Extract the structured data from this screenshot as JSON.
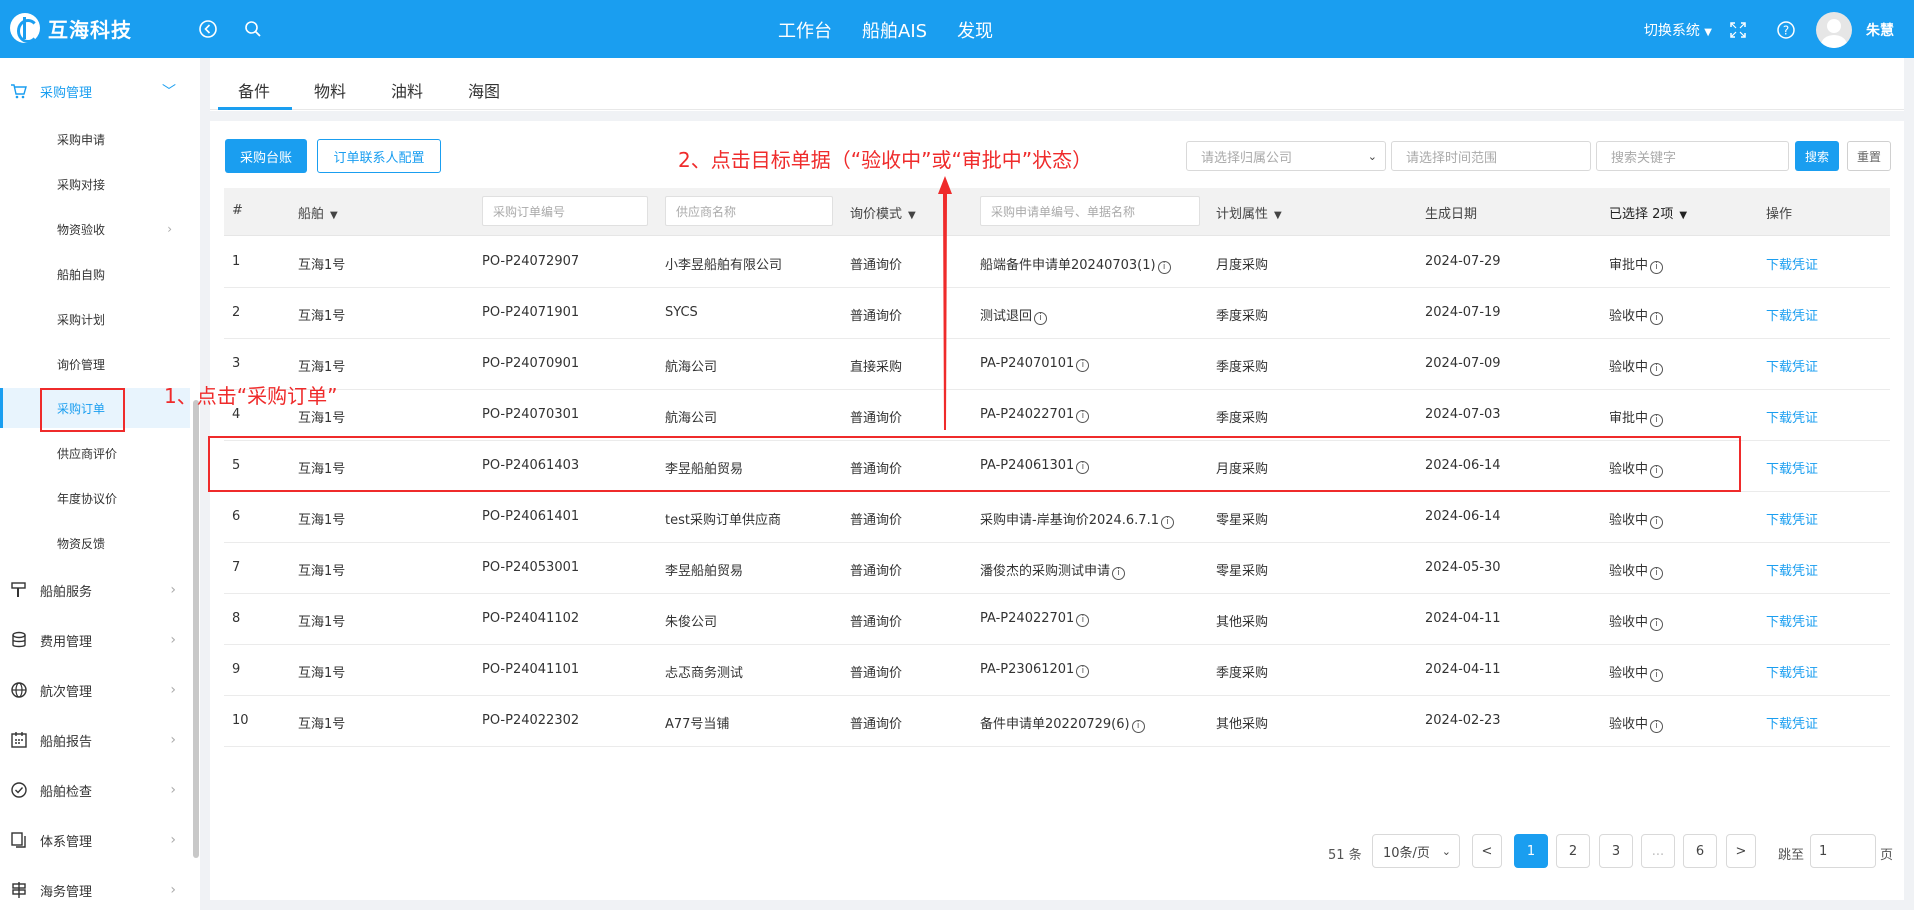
{
  "brand": {
    "name": "互海科技"
  },
  "top_nav": [
    "工作台",
    "船舶AIS",
    "发现"
  ],
  "header_right": {
    "switch_label": "切换系统",
    "username": "朱慧"
  },
  "sidebar": {
    "group_purchase": "采购管理",
    "items": [
      "采购申请",
      "采购对接",
      "物资验收",
      "船舶自购",
      "采购计划",
      "询价管理",
      "采购订单",
      "供应商评价",
      "年度协议价",
      "物资反馈"
    ],
    "groups": [
      "船舶服务",
      "费用管理",
      "航次管理",
      "船舶报告",
      "船舶检查",
      "体系管理",
      "海务管理"
    ]
  },
  "tabs": [
    "备件",
    "物料",
    "油料",
    "海图"
  ],
  "toolbar": {
    "btn_ledger": "采购台账",
    "btn_contact": "订单联系人配置",
    "company_placeholder": "请选择归属公司",
    "time_placeholder": "请选择时间范围",
    "keyword_placeholder": "搜索关键字",
    "search": "搜索",
    "reset": "重置"
  },
  "table": {
    "headers": {
      "index": "#",
      "ship": "船舶",
      "order_no_placeholder": "采购订单编号",
      "supplier_placeholder": "供应商名称",
      "mode": "询价模式",
      "request_placeholder": "采购申请单编号、单据名称",
      "plan": "计划属性",
      "date": "生成日期",
      "status": "已选择 2项",
      "op": "操作"
    },
    "rows": [
      {
        "idx": "1",
        "ship": "互海1号",
        "order": "PO-P24072907",
        "supplier": "小李昱船舶有限公司",
        "mode": "普通询价",
        "request": "船端备件申请单20240703(1)",
        "plan": "月度采购",
        "date": "2024-07-29",
        "status": "审批中",
        "op": "下载凭证"
      },
      {
        "idx": "2",
        "ship": "互海1号",
        "order": "PO-P24071901",
        "supplier": "SYCS",
        "mode": "普通询价",
        "request": "测试退回",
        "plan": "季度采购",
        "date": "2024-07-19",
        "status": "验收中",
        "op": "下载凭证"
      },
      {
        "idx": "3",
        "ship": "互海1号",
        "order": "PO-P24070901",
        "supplier": "航海公司",
        "mode": "直接采购",
        "request": "PA-P24070101",
        "plan": "季度采购",
        "date": "2024-07-09",
        "status": "验收中",
        "op": "下载凭证"
      },
      {
        "idx": "4",
        "ship": "互海1号",
        "order": "PO-P24070301",
        "supplier": "航海公司",
        "mode": "普通询价",
        "request": "PA-P24022701",
        "plan": "季度采购",
        "date": "2024-07-03",
        "status": "审批中",
        "op": "下载凭证"
      },
      {
        "idx": "5",
        "ship": "互海1号",
        "order": "PO-P24061403",
        "supplier": "李昱船舶贸易",
        "mode": "普通询价",
        "request": "PA-P24061301",
        "plan": "月度采购",
        "date": "2024-06-14",
        "status": "验收中",
        "op": "下载凭证"
      },
      {
        "idx": "6",
        "ship": "互海1号",
        "order": "PO-P24061401",
        "supplier": "test采购订单供应商",
        "mode": "普通询价",
        "request": "采购申请-岸基询价2024.6.7.1",
        "plan": "零星采购",
        "date": "2024-06-14",
        "status": "验收中",
        "op": "下载凭证"
      },
      {
        "idx": "7",
        "ship": "互海1号",
        "order": "PO-P24053001",
        "supplier": "李昱船舶贸易",
        "mode": "普通询价",
        "request": "潘俊杰的采购测试申请",
        "plan": "零星采购",
        "date": "2024-05-30",
        "status": "验收中",
        "op": "下载凭证"
      },
      {
        "idx": "8",
        "ship": "互海1号",
        "order": "PO-P24041102",
        "supplier": "朱俊公司",
        "mode": "普通询价",
        "request": "PA-P24022701",
        "plan": "其他采购",
        "date": "2024-04-11",
        "status": "验收中",
        "op": "下载凭证"
      },
      {
        "idx": "9",
        "ship": "互海1号",
        "order": "PO-P24041101",
        "supplier": "忐忑商务测试",
        "mode": "普通询价",
        "request": "PA-P23061201",
        "plan": "季度采购",
        "date": "2024-04-11",
        "status": "验收中",
        "op": "下载凭证"
      },
      {
        "idx": "10",
        "ship": "互海1号",
        "order": "PO-P24022302",
        "supplier": "A77号当铺",
        "mode": "普通询价",
        "request": "备件申请单20220729(6)",
        "plan": "其他采购",
        "date": "2024-02-23",
        "status": "验收中",
        "op": "下载凭证"
      }
    ]
  },
  "pagination": {
    "total": "51 条",
    "page_size": "10条/页",
    "prev": "<",
    "next": ">",
    "pages": [
      "1",
      "2",
      "3",
      "...",
      "6"
    ],
    "goto_label": "跳至",
    "goto_value": "1",
    "page_unit": "页"
  },
  "annotations": {
    "step1": "1、点击“采购订单”",
    "step2": "2、点击目标单据（“验收中”或“审批中”状态）"
  },
  "colors": {
    "primary": "#1a9ef0",
    "annotation": "#ef2b2b"
  }
}
